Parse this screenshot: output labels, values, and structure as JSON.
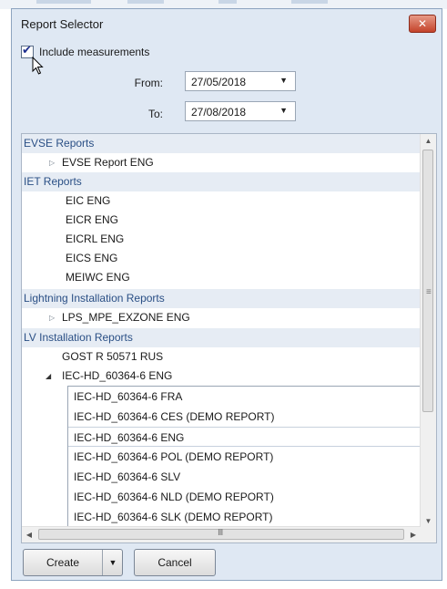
{
  "dialog": {
    "title": "Report Selector",
    "close_icon": "close-icon",
    "include_measurements": {
      "label": "Include measurements",
      "checked": true
    },
    "from": {
      "label": "From:",
      "value": "27/05/2018"
    },
    "to": {
      "label": "To:",
      "value": "27/08/2018"
    }
  },
  "report_list": {
    "groups": [
      {
        "label": "EVSE Reports",
        "items": [
          {
            "label": "EVSE Report ENG",
            "expander": "collapsed"
          }
        ]
      },
      {
        "label": "IET Reports",
        "items": [
          {
            "label": "EIC ENG"
          },
          {
            "label": "EICR ENG"
          },
          {
            "label": "EICRL ENG"
          },
          {
            "label": "EICS ENG"
          },
          {
            "label": "MEIWC ENG"
          }
        ]
      },
      {
        "label": "Lightning Installation Reports",
        "items": [
          {
            "label": "LPS_MPE_EXZONE ENG",
            "expander": "collapsed"
          }
        ]
      },
      {
        "label": "LV Installation Reports",
        "items": [
          {
            "label": "GOST R 50571 RUS"
          },
          {
            "label": "IEC-HD_60364-6 ENG",
            "expander": "expanded"
          }
        ]
      }
    ],
    "sub_items": [
      {
        "label": "IEC-HD_60364-6 FRA"
      },
      {
        "label": "IEC-HD_60364-6 CES (DEMO REPORT)"
      },
      {
        "label": "IEC-HD_60364-6 ENG",
        "selected": true
      },
      {
        "label": "IEC-HD_60364-6 POL (DEMO REPORT)"
      },
      {
        "label": "IEC-HD_60364-6 SLV"
      },
      {
        "label": "IEC-HD_60364-6 NLD (DEMO REPORT)"
      },
      {
        "label": "IEC-HD_60364-6 SLK (DEMO REPORT)"
      }
    ],
    "scroll_grip_h": "III",
    "scroll_grip_v": "≡"
  },
  "footer": {
    "create_label": "Create",
    "cancel_label": "Cancel"
  },
  "colors": {
    "dialog_bg": "#dfe8f3",
    "group_header_text": "#2a4f85",
    "close_button": "#c4432a"
  }
}
